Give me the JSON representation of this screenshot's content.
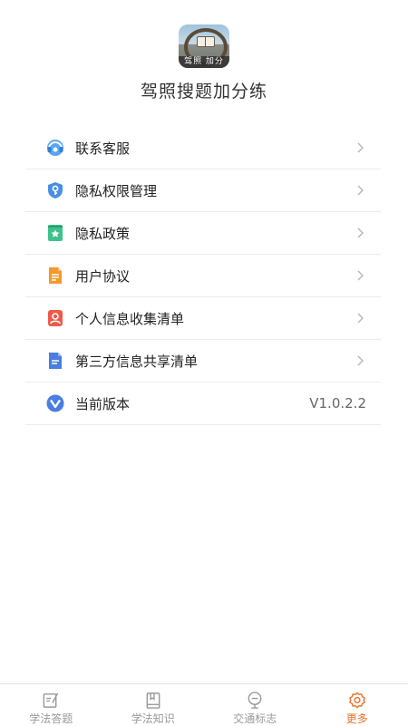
{
  "header": {
    "app_icon_text": "驾照  加分",
    "app_name": "驾照搜题加分练"
  },
  "menu": {
    "items": [
      {
        "label": "联系客服",
        "icon": "customer-service-icon",
        "color": "#3a8ee6"
      },
      {
        "label": "隐私权限管理",
        "icon": "shield-key-icon",
        "color": "#4a90e2"
      },
      {
        "label": "隐私政策",
        "icon": "star-bookmark-icon",
        "color": "#3cc28a"
      },
      {
        "label": "用户协议",
        "icon": "document-icon",
        "color": "#f39a2a"
      },
      {
        "label": "个人信息收集清单",
        "icon": "person-card-icon",
        "color": "#ee5a4a"
      },
      {
        "label": "第三方信息共享清单",
        "icon": "file-list-icon",
        "color": "#4a7ee0"
      },
      {
        "label": "当前版本",
        "icon": "version-icon",
        "color": "#4a7ee0",
        "value": "V1.0.2.2"
      }
    ]
  },
  "tabbar": {
    "tabs": [
      {
        "label": "学法答题",
        "icon": "edit-paper-icon"
      },
      {
        "label": "学法知识",
        "icon": "book-icon"
      },
      {
        "label": "交通标志",
        "icon": "road-sign-icon"
      },
      {
        "label": "更多",
        "icon": "gear-icon",
        "active": true
      }
    ],
    "active_color": "#e8732a",
    "inactive_color": "#999999"
  }
}
